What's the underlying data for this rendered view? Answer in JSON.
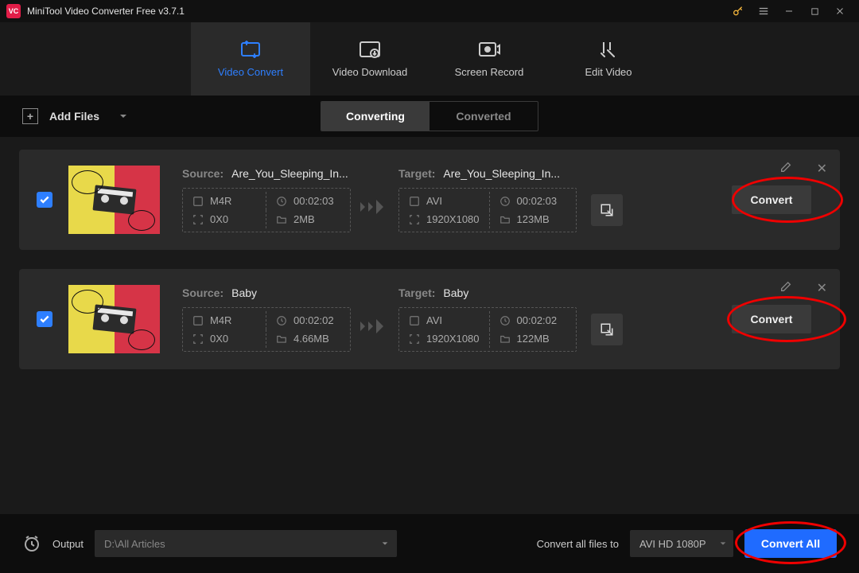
{
  "app": {
    "title": "MiniTool Video Converter Free v3.7.1",
    "logo": "VC"
  },
  "main_tabs": {
    "convert": "Video Convert",
    "download": "Video Download",
    "record": "Screen Record",
    "edit": "Edit Video"
  },
  "toolbar": {
    "add_files": "Add Files",
    "sub_converting": "Converting",
    "sub_converted": "Converted"
  },
  "labels": {
    "source": "Source:",
    "target": "Target:"
  },
  "items": [
    {
      "checked": true,
      "source_name": "Are_You_Sleeping_In...",
      "target_name": "Are_You_Sleeping_In...",
      "src": {
        "format": "M4R",
        "duration": "00:02:03",
        "resolution": "0X0",
        "size": "2MB"
      },
      "tgt": {
        "format": "AVI",
        "duration": "00:02:03",
        "resolution": "1920X1080",
        "size": "123MB"
      },
      "convert": "Convert"
    },
    {
      "checked": true,
      "source_name": "Baby",
      "target_name": "Baby",
      "src": {
        "format": "M4R",
        "duration": "00:02:02",
        "resolution": "0X0",
        "size": "4.66MB"
      },
      "tgt": {
        "format": "AVI",
        "duration": "00:02:02",
        "resolution": "1920X1080",
        "size": "122MB"
      },
      "convert": "Convert"
    }
  ],
  "bottombar": {
    "output_label": "Output",
    "output_path": "D:\\All Articles",
    "all_label": "Convert all files to",
    "preset": "AVI HD 1080P",
    "convert_all": "Convert All"
  }
}
